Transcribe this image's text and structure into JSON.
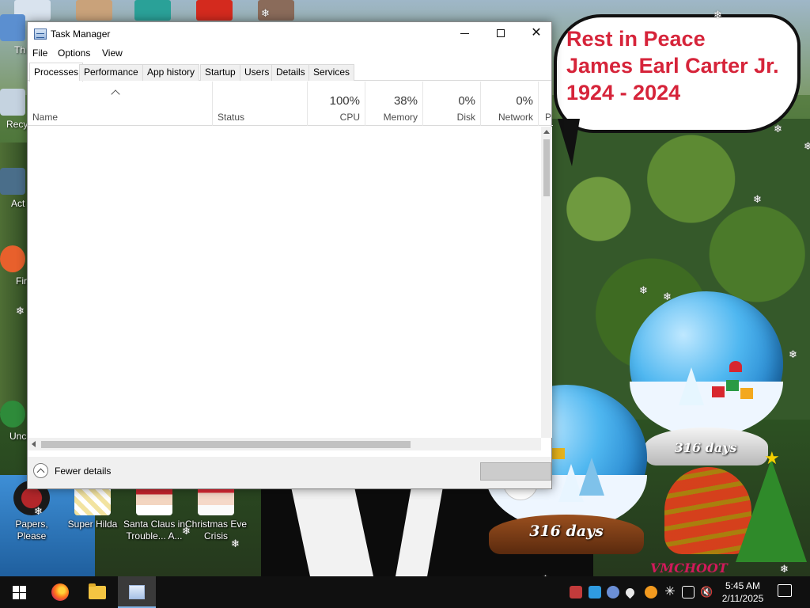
{
  "bubble": {
    "line1": "Rest in Peace",
    "line2": "James Earl Carter Jr.",
    "line3": "1924 - 2024"
  },
  "globes": {
    "small_label": "316 days",
    "large_label": "316 days"
  },
  "desktop": {
    "partial_labels": [
      "Th",
      "Recy",
      "Act",
      "Fir",
      "Unc"
    ],
    "icons": [
      {
        "label": "Papers, Please",
        "icon": "passport-icon"
      },
      {
        "label": "Super Hilda",
        "icon": "game-icon"
      },
      {
        "label": "Santa Claus in Trouble... A...",
        "icon": "santa-icon"
      },
      {
        "label": "Christmas Eve Crisis",
        "icon": "santa-icon"
      }
    ]
  },
  "task_manager": {
    "title": "Task Manager",
    "menu": [
      "File",
      "Options",
      "View"
    ],
    "tabs": [
      "Processes",
      "Performance",
      "App history",
      "Startup",
      "Users",
      "Details",
      "Services"
    ],
    "active_tab": "Processes",
    "columns": {
      "name": "Name",
      "status": "Status",
      "cpu": {
        "label": "CPU",
        "value": "100%"
      },
      "memory": {
        "label": "Memory",
        "value": "38%"
      },
      "disk": {
        "label": "Disk",
        "value": "0%"
      },
      "network": {
        "label": "Network",
        "value": "0%"
      },
      "power": "P"
    },
    "footer": {
      "fewer_details": "Fewer details"
    }
  },
  "taskbar": {
    "pinned": [
      "start-button",
      "firefox",
      "file-explorer",
      "task-manager"
    ],
    "clock": {
      "time": "5:45 AM",
      "date": "2/11/2025"
    }
  },
  "colors": {
    "bubble_text": "#d6243a",
    "taskbar": "#101010",
    "accent": "#7fb2e5"
  }
}
